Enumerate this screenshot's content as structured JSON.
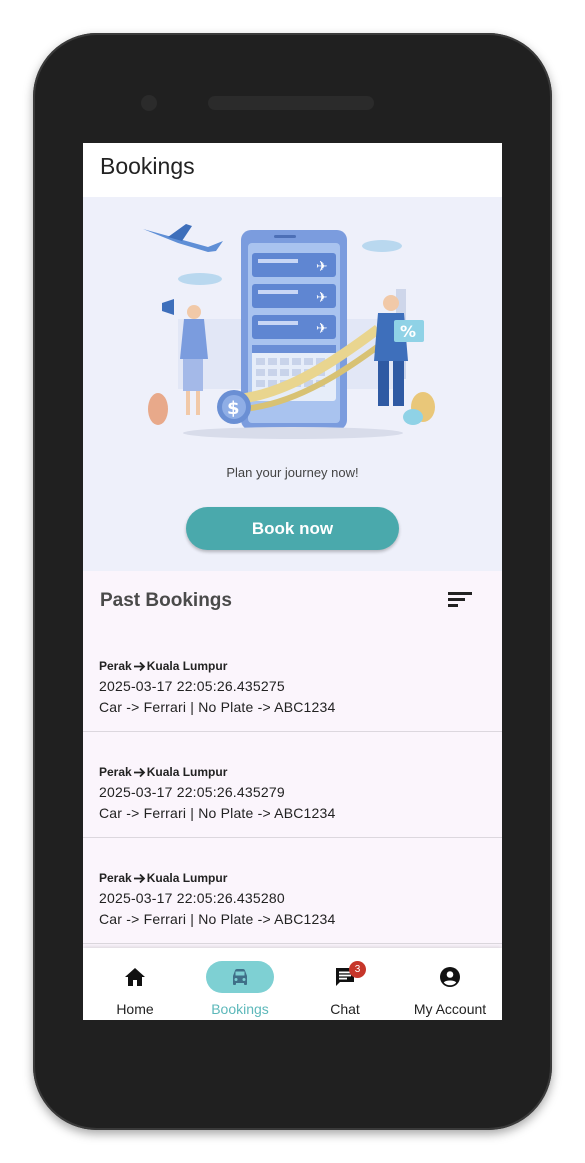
{
  "appbar": {
    "title": "Bookings"
  },
  "hero": {
    "tagline": "Plan your journey now!",
    "book_button": "Book now"
  },
  "past_bookings": {
    "title": "Past Bookings",
    "items": [
      {
        "from": "Perak",
        "to": "Kuala Lumpur",
        "datetime": "2025-03-17 22:05:26.435275",
        "details": "Car -> Ferrari | No Plate -> ABC1234"
      },
      {
        "from": "Perak",
        "to": "Kuala Lumpur",
        "datetime": "2025-03-17 22:05:26.435279",
        "details": "Car -> Ferrari | No Plate -> ABC1234"
      },
      {
        "from": "Perak",
        "to": "Kuala Lumpur",
        "datetime": "2025-03-17 22:05:26.435280",
        "details": "Car -> Ferrari | No Plate -> ABC1234"
      }
    ]
  },
  "bottom_nav": {
    "items": [
      {
        "label": "Home",
        "icon": "home-icon",
        "active": false
      },
      {
        "label": "Bookings",
        "icon": "car-icon",
        "active": true
      },
      {
        "label": "Chat",
        "icon": "chat-icon",
        "active": false,
        "badge": "3"
      },
      {
        "label": "My Account",
        "icon": "account-icon",
        "active": false
      }
    ]
  },
  "colors": {
    "accent": "#4aa9ac",
    "active_pill": "#7ed0d3",
    "badge": "#c6362a",
    "hero_bg": "#eef0fa",
    "list_bg": "#fbf5fc"
  }
}
